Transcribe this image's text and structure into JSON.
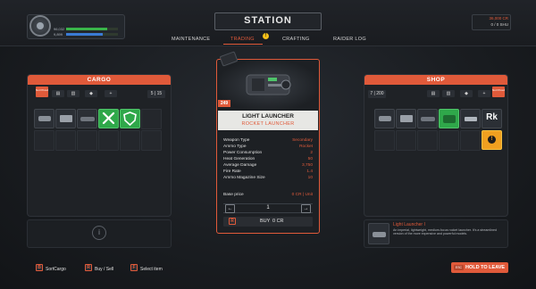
{
  "header": {
    "title": "STATION",
    "tabs": [
      {
        "label": "MAINTENANCE",
        "active": false
      },
      {
        "label": "TRADING",
        "active": true,
        "alert": "!"
      },
      {
        "label": "CRAFTING",
        "active": false
      },
      {
        "label": "RAIDER LOG",
        "active": false
      }
    ],
    "player": {
      "line1": "96,032",
      "line2": "9,899"
    },
    "currency": {
      "credits": "36,000 CR",
      "shu": "0 / 0 SHU"
    }
  },
  "cargo": {
    "title": "CARGO",
    "filter_label": "Not Priced",
    "count": "5 | 15",
    "items": [
      {
        "icon": "launcher-icon",
        "style": "dark"
      },
      {
        "icon": "turret-icon",
        "style": "dark"
      },
      {
        "icon": "cannon-icon",
        "style": "dark"
      },
      {
        "icon": "tools-icon",
        "style": "green"
      },
      {
        "icon": "shield-icon",
        "style": "green"
      }
    ],
    "info_icon": "i"
  },
  "shop": {
    "title": "SHOP",
    "filter_label": "Not Priced",
    "count": "7 | 200",
    "items": [
      {
        "icon": "launcher-icon",
        "style": "dark"
      },
      {
        "icon": "turret-icon",
        "style": "dark"
      },
      {
        "icon": "cannon-icon",
        "style": "dark"
      },
      {
        "icon": "green-weapon-icon",
        "style": "green"
      },
      {
        "icon": "gun-icon",
        "style": "dark"
      },
      {
        "icon": "rk-icon",
        "style": "dark",
        "label": "Rk"
      },
      {
        "icon": "alert-icon",
        "style": "orange"
      }
    ],
    "selected_name": "Light Launcher I",
    "selected_desc": "An imperial, lightweight, medium-focus rocket launcher. It's a streamlined version of the more expensive and powerful models."
  },
  "item": {
    "badge": "249",
    "name": "LIGHT LAUNCHER",
    "type": "ROCKET LAUNCHER",
    "stats": [
      {
        "label": "Weapon Type",
        "value": "Secondary"
      },
      {
        "label": "Ammo Type",
        "value": "Rocket"
      },
      {
        "label": "Power Consumption",
        "value": "2"
      },
      {
        "label": "Heat Generation",
        "value": "50"
      },
      {
        "label": "Average Damage",
        "value": "3,750"
      },
      {
        "label": "Fire Rate",
        "value": "1.4"
      },
      {
        "label": "Ammo Magazine Size",
        "value": "10"
      }
    ],
    "base_price_label": "Base price",
    "base_price_value": "0 CR | Unit",
    "quantity": "1",
    "dec": "←",
    "inc": "→",
    "buy_key": "R",
    "buy_label": "BUY",
    "buy_price": "0 CR"
  },
  "footer": {
    "hints": [
      {
        "key": "B",
        "label": "SortCargo"
      },
      {
        "key": "R",
        "label": "Buy / Sell"
      },
      {
        "key": "F",
        "label": "Select item"
      }
    ],
    "leave_key": "ESC",
    "leave_label": "HOLD TO LEAVE"
  },
  "colors": {
    "accent": "#e05a3a",
    "green": "#2fa84a",
    "panel": "#1f2226",
    "warn": "#f5c019"
  }
}
